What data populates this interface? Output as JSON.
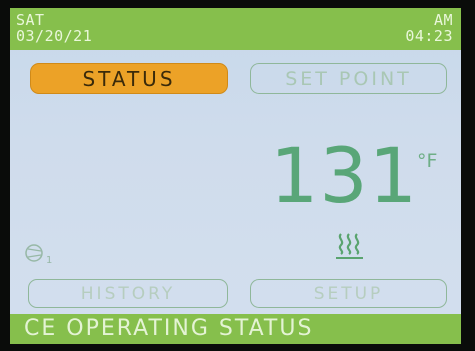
{
  "header": {
    "day": "SAT",
    "date": "03/20/21",
    "ampm": "AM",
    "time": "04:23"
  },
  "nav": {
    "status_label": "STATUS",
    "setpoint_label": "SET POINT",
    "history_label": "HISTORY",
    "setup_label": "SETUP",
    "active_tab": "STATUS"
  },
  "reading": {
    "temperature": "131",
    "unit": "°F"
  },
  "indicators": {
    "pump_icon": "pump-icon",
    "pump_number": "1",
    "heat_icon": "heating-icon"
  },
  "footer": {
    "message": "CE OPERATING STATUS"
  },
  "colors": {
    "bar_green": "#86bf4c",
    "active_button": "#eca227",
    "temperature_green": "#59a678",
    "screen_background": "#cfdcec"
  }
}
